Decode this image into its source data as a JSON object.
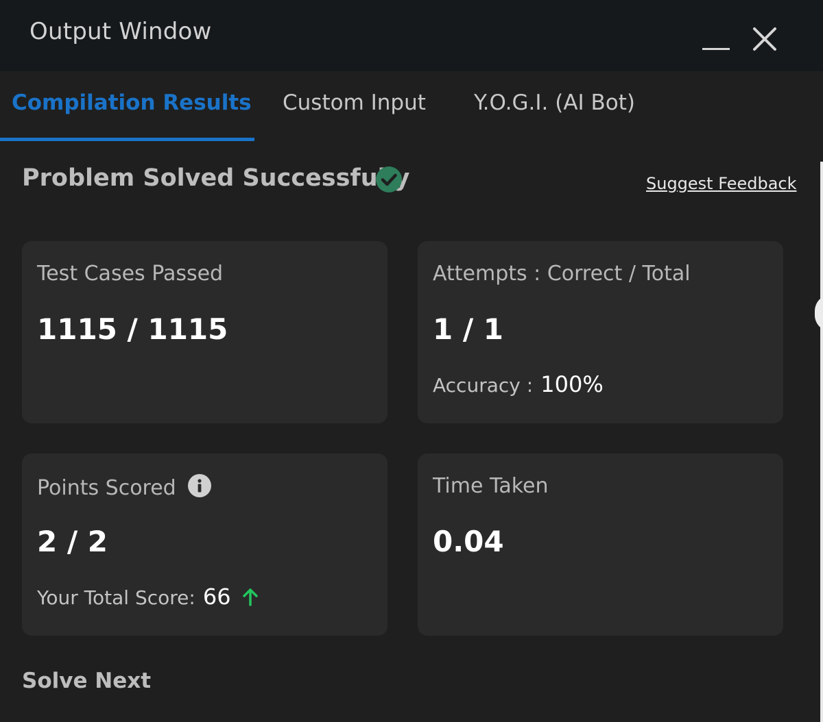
{
  "window": {
    "title": "Output Window"
  },
  "tabs": [
    {
      "label": "Compilation Results",
      "active": true
    },
    {
      "label": "Custom Input",
      "active": false
    },
    {
      "label": "Y.O.G.I. (AI Bot)",
      "active": false
    }
  ],
  "status": {
    "title": "Problem Solved Successfully",
    "icon": "check-circle-icon",
    "feedback_link": "Suggest Feedback"
  },
  "cards": {
    "test_cases": {
      "label": "Test Cases Passed",
      "value": "1115 / 1115"
    },
    "attempts": {
      "label": "Attempts : Correct / Total",
      "value": "1 / 1",
      "sub_label": "Accuracy :",
      "sub_value": "100%"
    },
    "points": {
      "label": "Points Scored",
      "value": "2 / 2",
      "sub_label": "Your Total Score:",
      "sub_value": "66",
      "info_icon": "info-icon",
      "trend_icon": "arrow-up-icon"
    },
    "time": {
      "label": "Time Taken",
      "value": "0.04"
    }
  },
  "solve_next": "Solve Next",
  "colors": {
    "accent": "#1a73c8",
    "success": "#2e7d5b",
    "trend_up": "#22c55e",
    "background": "#1f1f1f",
    "card": "#2a2a2a"
  }
}
